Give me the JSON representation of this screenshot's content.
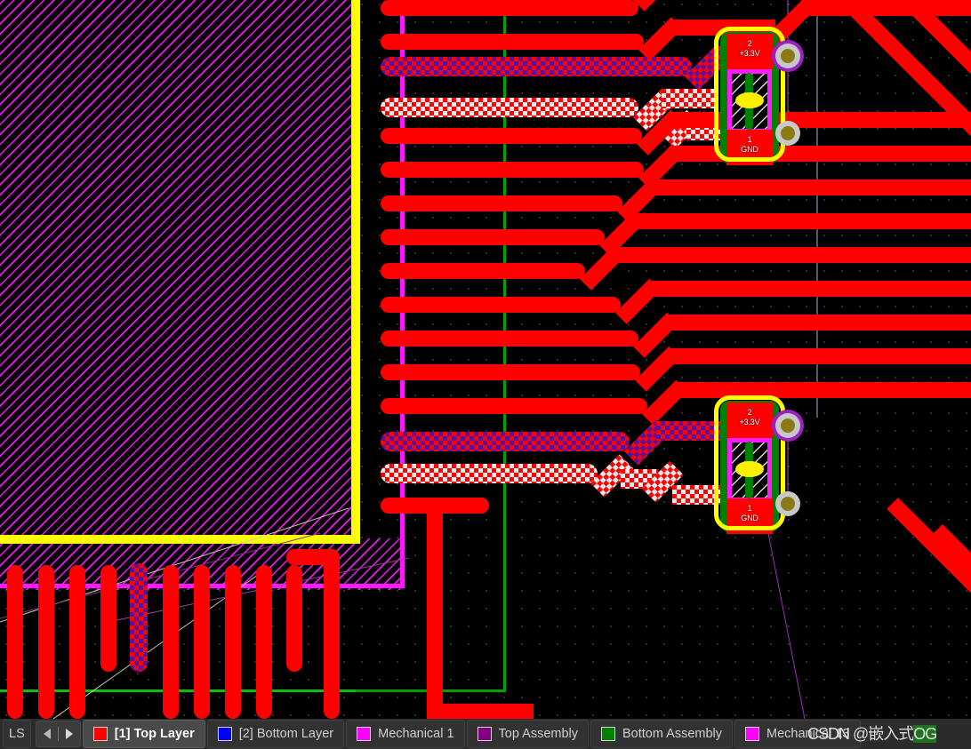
{
  "app": {
    "view": "pcb-layout-editor",
    "canvas_background": "#000000"
  },
  "colors": {
    "top_layer": "#ff0000",
    "bottom_layer": "#0000ff",
    "mechanical_1": "#ff00ff",
    "top_assembly": "#800080",
    "bottom_assembly": "#008000",
    "mechanical_13": "#ff00ff",
    "board_outline": "#00a000",
    "room_outline": "#ffff00",
    "polygon_hatch": "#ff19ff",
    "via_hole": "#8a7a14",
    "via_ring": "#c8c8c8",
    "selection_highlight": "#ffffff"
  },
  "layer_bar": {
    "edge_tab_label": "LS",
    "nav_prev_icon": "triangle-left-icon",
    "nav_next_icon": "triangle-right-icon",
    "tabs": [
      {
        "label": "[1] Top Layer",
        "color": "#ff0000",
        "active": true
      },
      {
        "label": "[2] Bottom Layer",
        "color": "#0000ff",
        "active": false
      },
      {
        "label": "Mechanical 1",
        "color": "#ff00ff",
        "active": false
      },
      {
        "label": "Top Assembly",
        "color": "#800080",
        "active": false
      },
      {
        "label": "Bottom Assembly",
        "color": "#008000",
        "active": false
      },
      {
        "label": "Mechanical 13",
        "color": "#ff00ff",
        "active": false
      }
    ]
  },
  "components": [
    {
      "id": "cap-upper",
      "type": "capacitor-footprint",
      "selected": true,
      "pads": [
        {
          "number": "2",
          "net": "+3.3V",
          "highlight": "purple-checker"
        },
        {
          "number": "1",
          "net": "GND",
          "highlight": "white-checker"
        }
      ]
    },
    {
      "id": "cap-lower",
      "type": "capacitor-footprint",
      "selected": true,
      "pads": [
        {
          "number": "2",
          "net": "+3.3V",
          "highlight": "purple-checker"
        },
        {
          "number": "1",
          "net": "GND",
          "highlight": "white-checker"
        }
      ]
    }
  ],
  "selected_nets": [
    {
      "name": "+3.3V",
      "highlight": "purple-checker"
    },
    {
      "name": "GND",
      "highlight": "white-checker"
    }
  ],
  "watermark": {
    "prefix": "CSDN @",
    "author": "嵌入式",
    "suffix": "OG",
    "overlapped_tab": "Mechanical 13"
  }
}
